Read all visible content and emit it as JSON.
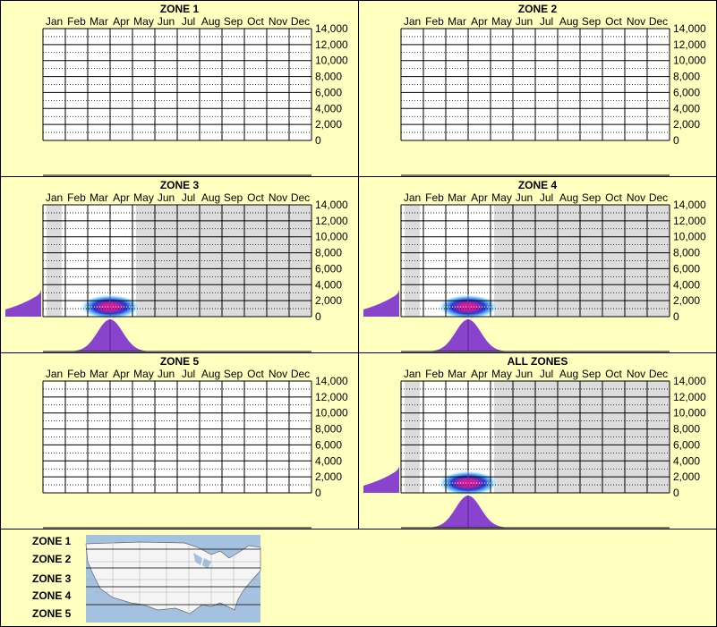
{
  "months": [
    "Jan",
    "Feb",
    "Mar",
    "Apr",
    "May",
    "Jun",
    "Jul",
    "Aug",
    "Sep",
    "Oct",
    "Nov",
    "Dec"
  ],
  "yticks": [
    "14,000",
    "12,000",
    "10,000",
    "8,000",
    "6,000",
    "4,000",
    "2,000",
    "0"
  ],
  "colors": {
    "background": "#ffffc0",
    "shade": "#dcdcdc",
    "density": "#8844cc",
    "heat_core": "#ff1493",
    "heat_mid": "#1e3cd2",
    "heat_outer": "#64c8ff"
  },
  "chart_data": [
    {
      "type": "heatmap",
      "title": "ZONE 1",
      "ylim": [
        0,
        14000
      ],
      "has_data": false
    },
    {
      "type": "heatmap",
      "title": "ZONE 2",
      "ylim": [
        0,
        14000
      ],
      "has_data": false
    },
    {
      "type": "heatmap",
      "title": "ZONE 3",
      "ylim": [
        0,
        14000
      ],
      "has_data": true,
      "peak": {
        "month": "Mar-Apr",
        "elevation": 1000
      },
      "shaded": "all months except Feb-Apr"
    },
    {
      "type": "heatmap",
      "title": "ZONE 4",
      "ylim": [
        0,
        14000
      ],
      "has_data": true,
      "peak": {
        "month": "Mar-Apr",
        "elevation": 1000
      },
      "shaded": "all months except Feb-Apr"
    },
    {
      "type": "heatmap",
      "title": "ZONE 5",
      "ylim": [
        0,
        14000
      ],
      "has_data": false
    },
    {
      "type": "heatmap",
      "title": "ALL ZONES",
      "ylim": [
        0,
        14000
      ],
      "has_data": true,
      "peak": {
        "month": "Mar-Apr",
        "elevation": 1000
      },
      "shaded": "all months except Feb-Apr"
    }
  ],
  "legend": {
    "zones": [
      "ZONE 1",
      "ZONE 2",
      "ZONE 3",
      "ZONE 4",
      "ZONE 5"
    ]
  }
}
